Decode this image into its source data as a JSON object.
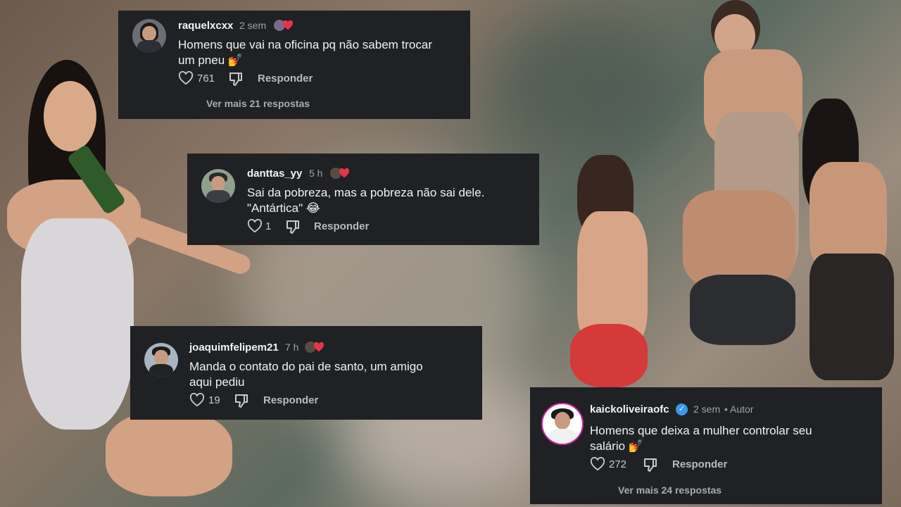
{
  "comments": [
    {
      "username": "raquelxcxx",
      "time": "2 sem",
      "line1": "Homens que vai na oficina pq não sabem trocar",
      "line2": "um pneu 💅",
      "likes": "761",
      "reply_label": "Responder",
      "more": "Ver mais 21 respostas"
    },
    {
      "username": "danttas_yy",
      "time": "5 h",
      "line1": "Sai da pobreza, mas a pobreza não sai dele.",
      "line2": "\"Antártica\" 😂",
      "likes": "1",
      "reply_label": "Responder"
    },
    {
      "username": "joaquimfelipem21",
      "time": "7 h",
      "line1": "Manda o contato do pai de santo, um amigo",
      "line2": "aqui pediu",
      "likes": "19",
      "reply_label": "Responder"
    },
    {
      "username": "kaickoliveiraofc",
      "time": "2 sem",
      "author": "• Autor",
      "line1": "Homens que deixa a mulher controlar seu",
      "line2": "salário 💅",
      "likes": "272",
      "reply_label": "Responder",
      "more": "Ver mais 24 respostas"
    }
  ],
  "colors": {
    "card_bg": "#1f2124",
    "heart": "#e8344a",
    "verified": "#3897f0"
  }
}
